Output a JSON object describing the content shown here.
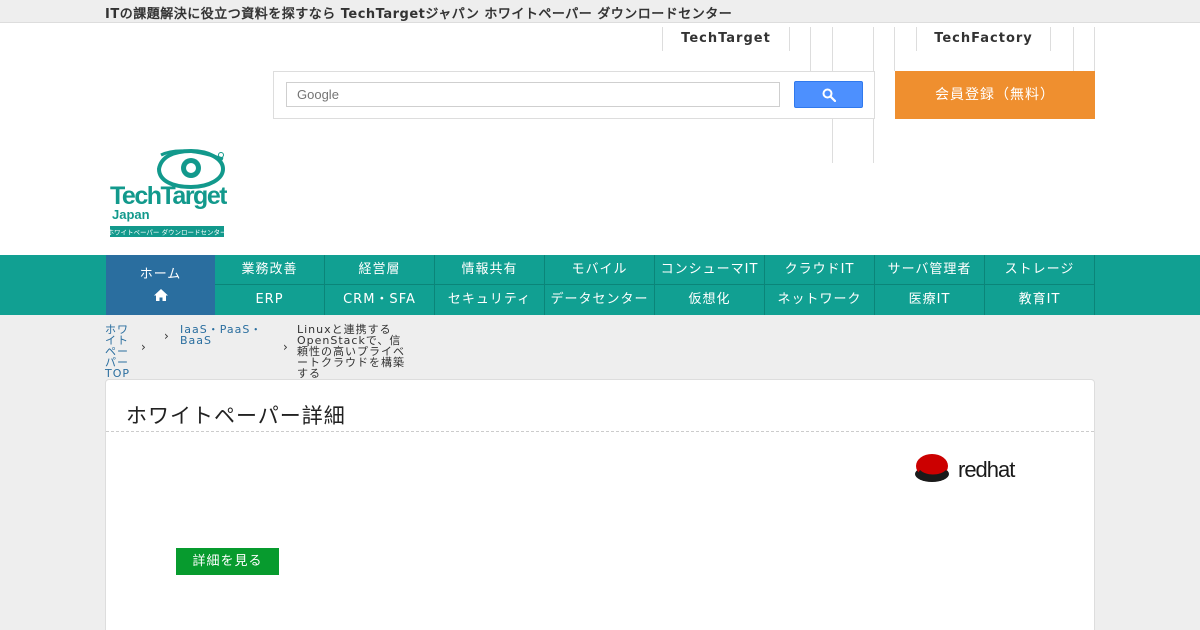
{
  "topbar": {
    "tagline": "ITの課題解決に役立つ資料を探すなら TechTargetジャパン ホワイトペーパー ダウンロードセンター"
  },
  "header": {
    "links": [
      "TechTarget",
      "TechFactory"
    ],
    "search": {
      "placeholder": "Google"
    },
    "register_label": "会員登録（無料）"
  },
  "logo": {
    "brand_line1": "TechTarget",
    "brand_line2": "Japan",
    "subtitle": "ホワイトペーパー ダウンロードセンター",
    "brand_color": "#12998c"
  },
  "nav": {
    "home_label": "ホーム",
    "row1": [
      "業務改善",
      "経営層",
      "情報共有",
      "モバイル",
      "コンシューマIT",
      "クラウドIT",
      "サーバ管理者",
      "ストレージ"
    ],
    "row2": [
      "ERP",
      "CRM・SFA",
      "セキュリティ",
      "データセンター",
      "仮想化",
      "ネットワーク",
      "医療IT",
      "教育IT"
    ]
  },
  "breadcrumb": {
    "items": [
      "ホワイトペーパーTOP",
      "IaaS・PaaS・BaaS",
      "Linuxと連携するOpenStackで、信頼性の高いプライベートクラウドを構築する"
    ]
  },
  "panel": {
    "title": "ホワイトペーパー詳細",
    "vendor_logo_text": "redhat",
    "detail_button_label": "詳細を見る"
  },
  "colors": {
    "nav_bg": "#11a092",
    "nav_home_bg": "#2a6e9f",
    "register_bg": "#ef8f2f",
    "detail_bg": "#079b2e",
    "link": "#2a6e9f"
  }
}
